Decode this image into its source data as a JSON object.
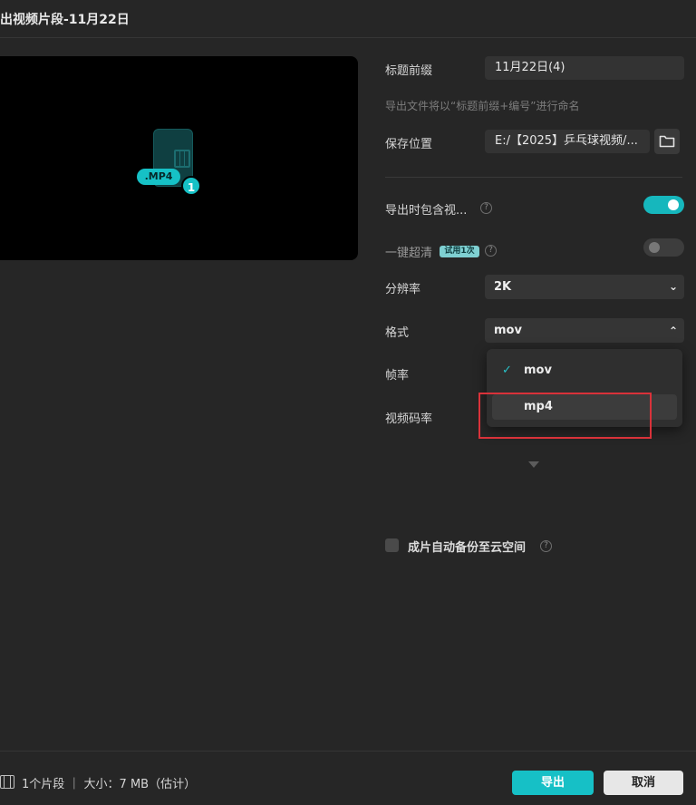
{
  "window": {
    "title": "出视频片段-11月22日"
  },
  "preview": {
    "format_badge": ".MP4",
    "clip_count": "1"
  },
  "form": {
    "title_prefix_label": "标题前缀",
    "title_prefix_value": "11月22日(4)",
    "naming_hint": "导出文件将以“标题前缀+编号”进行命名",
    "save_location_label": "保存位置",
    "save_location_value": "E:/【2025】乒乓球视频/...",
    "include_video_label": "导出时包含视...",
    "include_video_on": true,
    "super_res_label": "一键超清",
    "super_res_badge": "试用1次",
    "super_res_on": false,
    "resolution_label": "分辨率",
    "resolution_value": "2K",
    "format_label": "格式",
    "format_value": "mov",
    "framerate_label": "帧率",
    "bitrate_label": "视频码率",
    "backup_label": "成片自动备份至云空间",
    "backup_checked": false
  },
  "format_dropdown": {
    "options": [
      {
        "label": "mov",
        "selected": true
      },
      {
        "label": "mp4",
        "selected": false
      }
    ]
  },
  "footer": {
    "summary": "1个片段 ｜ 大小：7 MB（估计）",
    "export_label": "导出",
    "cancel_label": "取消"
  },
  "colors": {
    "accent": "#16c0c6",
    "highlight": "#d9323a"
  }
}
